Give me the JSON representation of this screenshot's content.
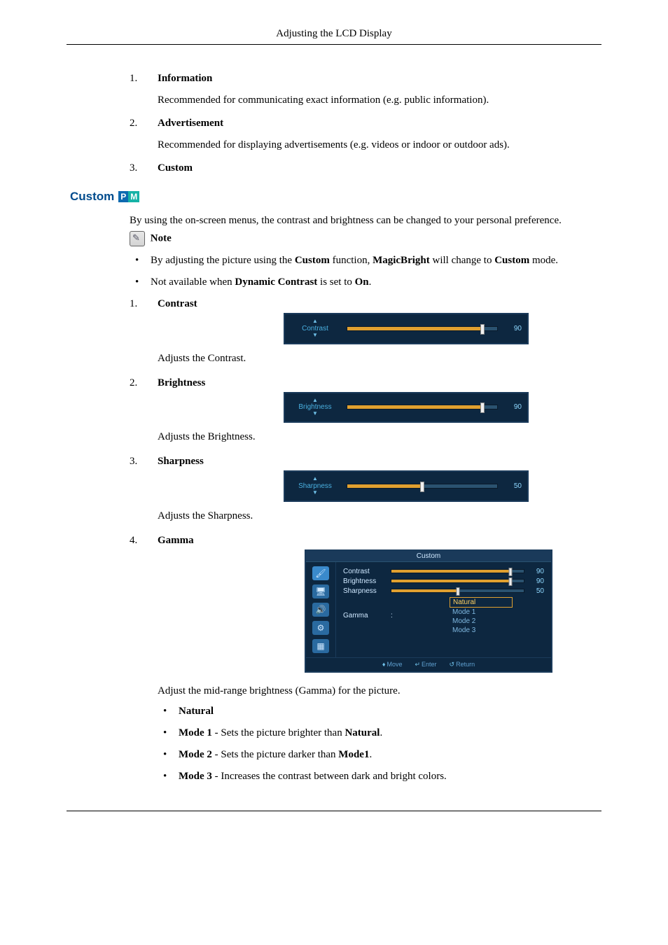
{
  "header": {
    "title": "Adjusting the LCD Display"
  },
  "intro_list": [
    {
      "num": "1.",
      "title": "Information",
      "desc": "Recommended for communicating exact information (e.g. public information)."
    },
    {
      "num": "2.",
      "title": "Advertisement",
      "desc": "Recommended for displaying advertisements (e.g. videos or indoor or outdoor ads)."
    },
    {
      "num": "3.",
      "title": "Custom",
      "desc": ""
    }
  ],
  "custom_section": {
    "heading": "Custom",
    "badge_p": "P",
    "badge_m": "M",
    "intro": "By using the on-screen menus, the contrast and brightness can be changed to your personal preference.",
    "note_label": "Note",
    "notes": [
      {
        "pre": "By adjusting the picture using the ",
        "b1": "Custom",
        "mid1": " function, ",
        "b2": "MagicBright",
        "mid2": " will change to ",
        "b3": "Custom",
        "post": " mode."
      },
      {
        "pre": "Not available when ",
        "b1": "Dynamic Contrast",
        "mid1": " is set to ",
        "b2": "On",
        "post": "."
      }
    ],
    "items": [
      {
        "num": "1.",
        "title": "Contrast",
        "slider_label": "Contrast",
        "value": "90",
        "percent": 90,
        "desc": "Adjusts the Contrast."
      },
      {
        "num": "2.",
        "title": "Brightness",
        "slider_label": "Brightness",
        "value": "90",
        "percent": 90,
        "desc": "Adjusts the Brightness."
      },
      {
        "num": "3.",
        "title": "Sharpness",
        "slider_label": "Sharpness",
        "value": "50",
        "percent": 50,
        "desc": "Adjusts the Sharpness."
      },
      {
        "num": "4.",
        "title": "Gamma",
        "desc": "Adjust the mid-range brightness (Gamma) for the picture."
      }
    ],
    "osd": {
      "title": "Custom",
      "rows": [
        {
          "label": "Contrast",
          "value": "90",
          "percent": 90
        },
        {
          "label": "Brightness",
          "value": "90",
          "percent": 90
        },
        {
          "label": "Sharpness",
          "value": "50",
          "percent": 50
        }
      ],
      "gamma_label": "Gamma",
      "colon": ":",
      "options": [
        "Natural",
        "Mode 1",
        "Mode 2",
        "Mode 3"
      ],
      "footer": {
        "move": "Move",
        "enter": "Enter",
        "return": "Return"
      }
    },
    "gamma_modes": [
      {
        "b1": "Natural",
        "rest": ""
      },
      {
        "b1": "Mode 1",
        "mid": " - Sets the picture brighter than ",
        "b2": "Natural",
        "post": "."
      },
      {
        "b1": "Mode 2",
        "mid": " - Sets the picture darker than ",
        "b2": "Mode1",
        "post": "."
      },
      {
        "b1": "Mode 3",
        "mid": " - Increases the contrast between dark and bright colors.",
        "b2": "",
        "post": ""
      }
    ]
  }
}
